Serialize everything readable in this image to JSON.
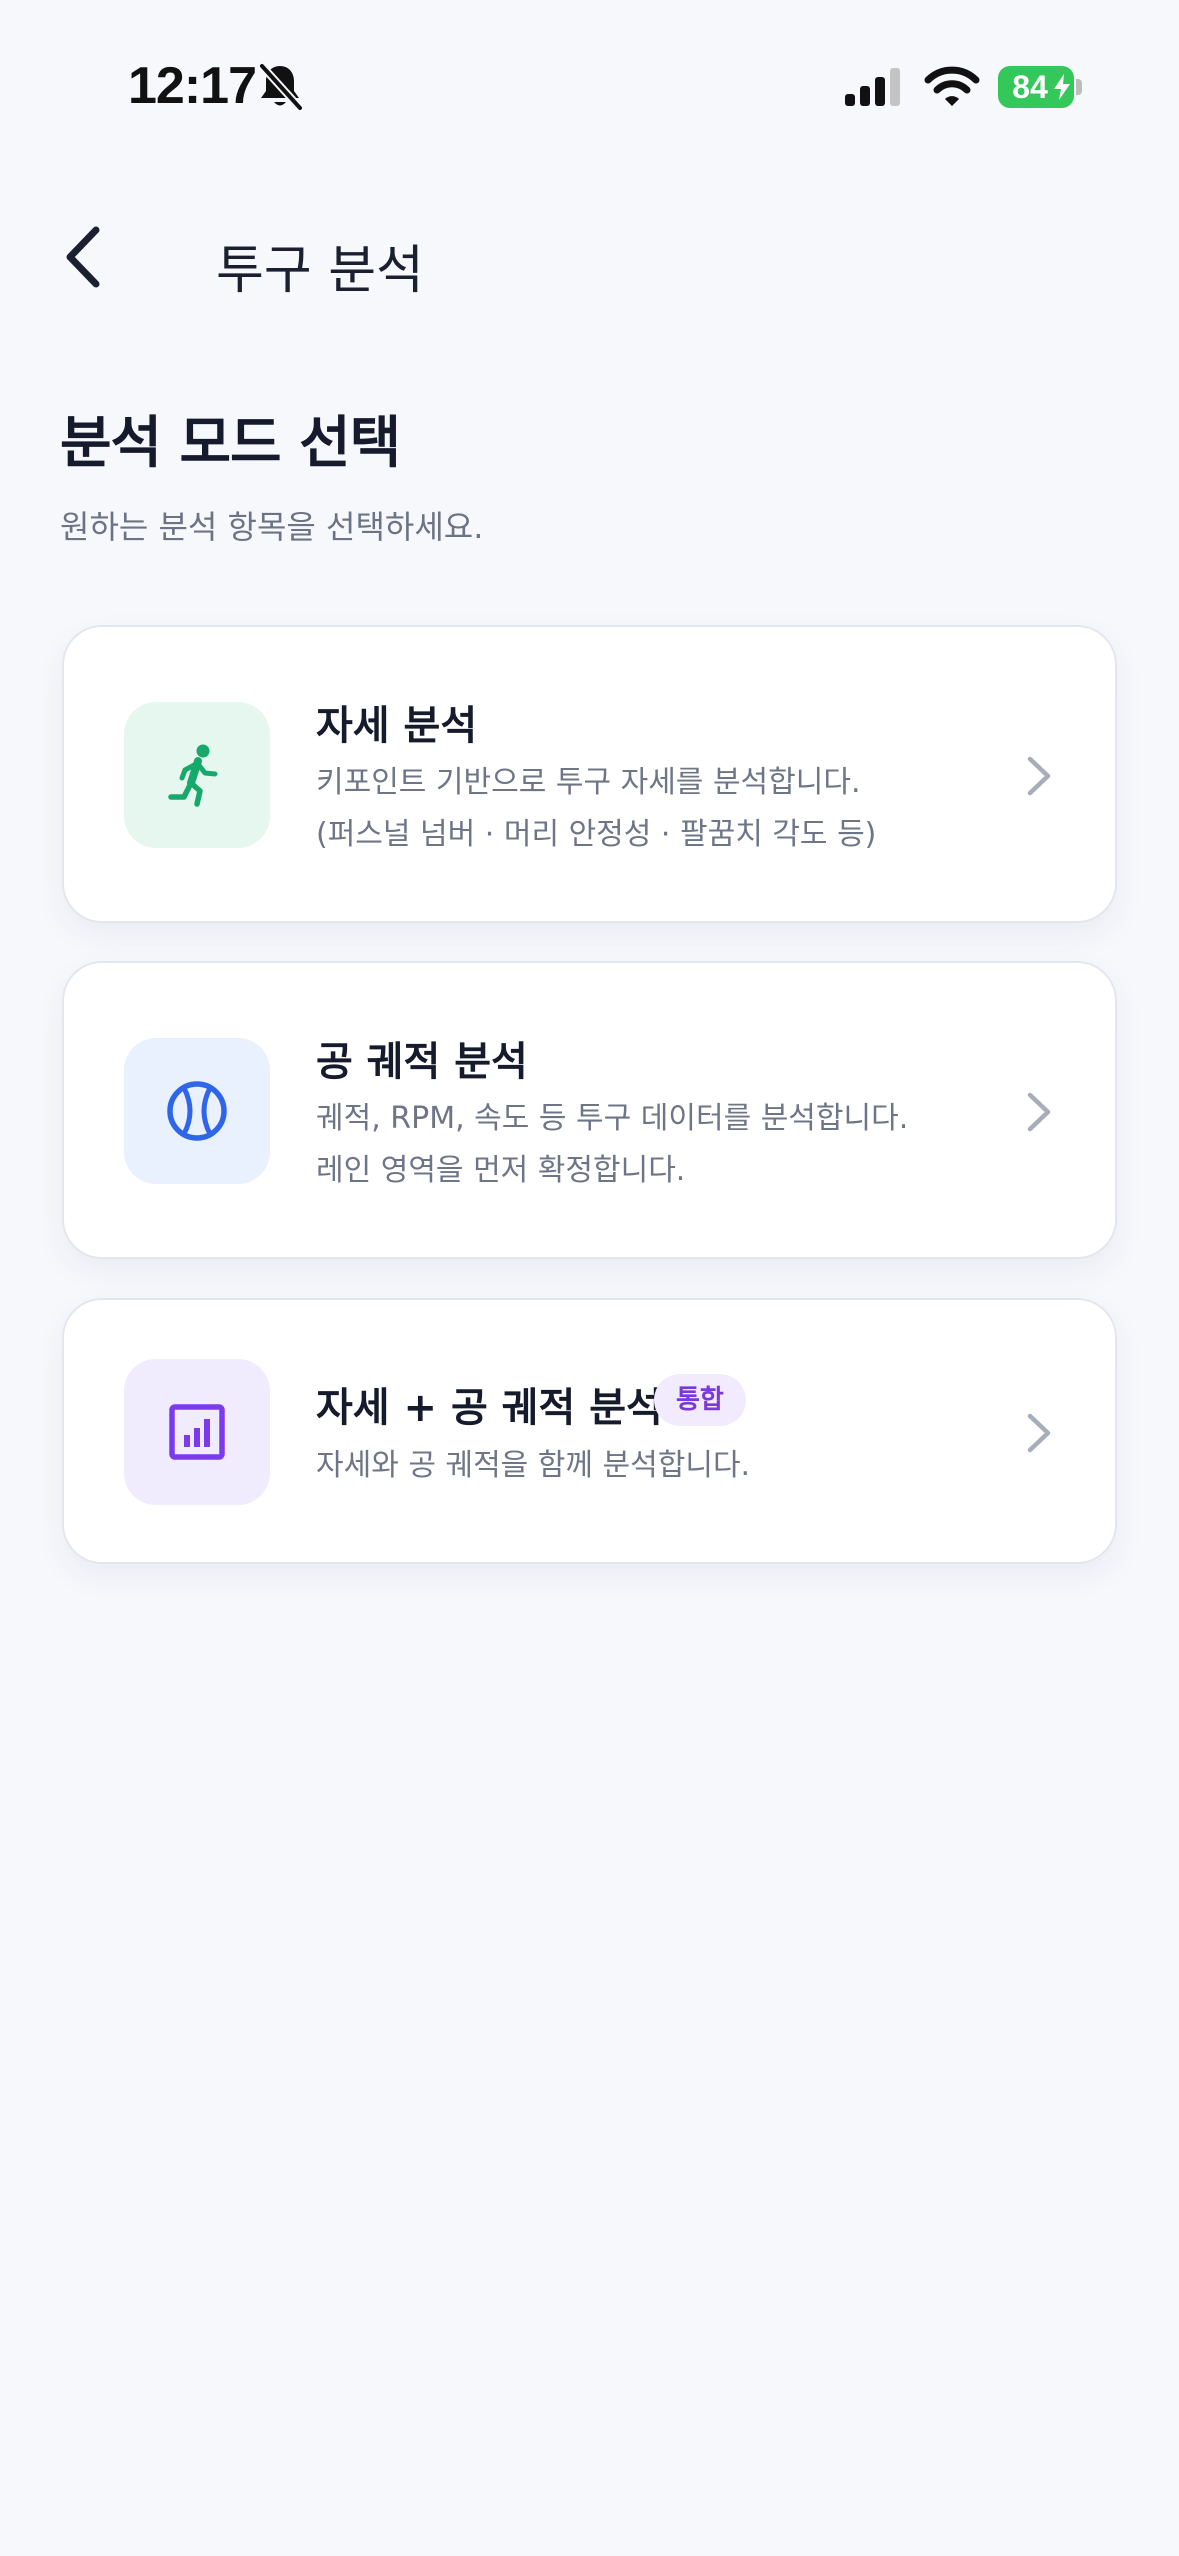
{
  "status_bar": {
    "time": "12:17",
    "battery_percent": "84",
    "battery_color": "#34c759"
  },
  "header": {
    "back_icon": "chevron-left-icon",
    "title": "투구 분석"
  },
  "intro": {
    "title": "분석 모드 선택",
    "subtitle": "원하는 분석 항목을 선택하세요."
  },
  "modes": [
    {
      "icon": "running-person-icon",
      "icon_color": "#16a96b",
      "title": "자세 분석",
      "desc_line1": "키포인트 기반으로 투구 자세를 분석합니다.",
      "desc_line2": "(퍼스널 넘버 · 머리 안정성 · 팔꿈치 각도 등)"
    },
    {
      "icon": "baseball-icon",
      "icon_color": "#2f66e8",
      "title": "공 궤적 분석",
      "desc_line1": "궤적, RPM, 속도 등 투구 데이터를 분석합니다.",
      "desc_line2": "레인 영역을 먼저 확정합니다."
    },
    {
      "icon": "bar-chart-icon",
      "icon_color": "#7c3aed",
      "title": "자세 + 공 궤적 분석",
      "badge": "통합",
      "desc_line1": "자세와 공 궤적을 함께 분석합니다."
    }
  ]
}
